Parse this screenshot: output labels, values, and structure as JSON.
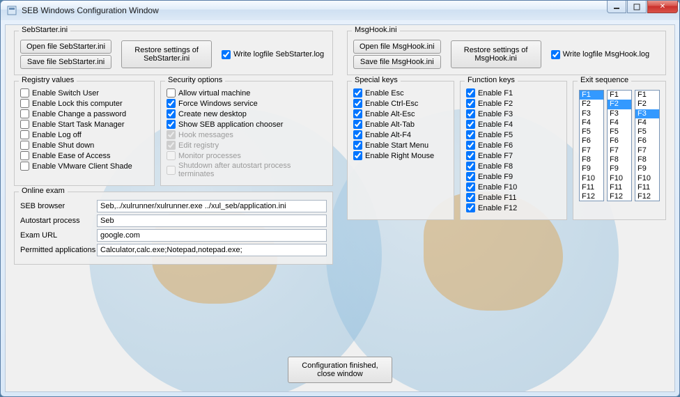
{
  "window": {
    "title": "SEB Windows Configuration Window"
  },
  "sebstarter": {
    "legend": "SebStarter.ini",
    "open_btn": "Open file SebStarter.ini",
    "save_btn": "Save file SebStarter.ini",
    "restore_btn": "Restore settings of\nSebStarter.ini",
    "logfile_label": "Write logfile SebStarter.log",
    "logfile_checked": true
  },
  "registry": {
    "legend": "Registry values",
    "items": [
      {
        "label": "Enable Switch User",
        "checked": false
      },
      {
        "label": "Enable Lock this computer",
        "checked": false
      },
      {
        "label": "Enable Change a password",
        "checked": false
      },
      {
        "label": "Enable Start Task Manager",
        "checked": false
      },
      {
        "label": "Enable Log off",
        "checked": false
      },
      {
        "label": "Enable Shut down",
        "checked": false
      },
      {
        "label": "Enable Ease of Access",
        "checked": false
      },
      {
        "label": "Enable VMware Client Shade",
        "checked": false
      }
    ]
  },
  "security": {
    "legend": "Security options",
    "items": [
      {
        "label": "Allow virtual machine",
        "checked": false,
        "disabled": false
      },
      {
        "label": "Force Windows service",
        "checked": true,
        "disabled": false
      },
      {
        "label": "Create new desktop",
        "checked": true,
        "disabled": false
      },
      {
        "label": "Show SEB application chooser",
        "checked": true,
        "disabled": false
      },
      {
        "label": "Hook messages",
        "checked": true,
        "disabled": true
      },
      {
        "label": "Edit registry",
        "checked": true,
        "disabled": true
      },
      {
        "label": "Monitor processes",
        "checked": false,
        "disabled": true
      },
      {
        "label": "Shutdown after autostart process terminates",
        "checked": false,
        "disabled": true
      }
    ]
  },
  "online_exam": {
    "legend": "Online exam",
    "seb_browser_label": "SEB browser",
    "seb_browser_value": "Seb,../xulrunner/xulrunner.exe ../xul_seb/application.ini",
    "autostart_label": "Autostart process",
    "autostart_value": "Seb",
    "exam_url_label": "Exam URL",
    "exam_url_value": "google.com",
    "permitted_label": "Permitted applications",
    "permitted_value": "Calculator,calc.exe;Notepad,notepad.exe;"
  },
  "msghook": {
    "legend": "MsgHook.ini",
    "open_btn": "Open file MsgHook.ini",
    "save_btn": "Save file MsgHook.ini",
    "restore_btn": "Restore settings of\nMsgHook.ini",
    "logfile_label": "Write logfile MsgHook.log",
    "logfile_checked": true
  },
  "special_keys": {
    "legend": "Special keys",
    "items": [
      {
        "label": "Enable Esc",
        "checked": true
      },
      {
        "label": "Enable Ctrl-Esc",
        "checked": true
      },
      {
        "label": "Enable Alt-Esc",
        "checked": true
      },
      {
        "label": "Enable Alt-Tab",
        "checked": true
      },
      {
        "label": "Enable Alt-F4",
        "checked": true
      },
      {
        "label": "Enable Start Menu",
        "checked": true
      },
      {
        "label": "Enable Right Mouse",
        "checked": true
      }
    ]
  },
  "function_keys": {
    "legend": "Function keys",
    "items": [
      {
        "label": "Enable F1",
        "checked": true
      },
      {
        "label": "Enable F2",
        "checked": true
      },
      {
        "label": "Enable F3",
        "checked": true
      },
      {
        "label": "Enable F4",
        "checked": true
      },
      {
        "label": "Enable F5",
        "checked": true
      },
      {
        "label": "Enable F6",
        "checked": true
      },
      {
        "label": "Enable F7",
        "checked": true
      },
      {
        "label": "Enable F8",
        "checked": true
      },
      {
        "label": "Enable F9",
        "checked": true
      },
      {
        "label": "Enable F10",
        "checked": true
      },
      {
        "label": "Enable F11",
        "checked": true
      },
      {
        "label": "Enable F12",
        "checked": true
      }
    ]
  },
  "exit_sequence": {
    "legend": "Exit sequence",
    "options": [
      "F1",
      "F2",
      "F3",
      "F4",
      "F5",
      "F6",
      "F7",
      "F8",
      "F9",
      "F10",
      "F11",
      "F12"
    ],
    "selected": [
      "F1",
      "F2",
      "F3"
    ]
  },
  "finish_btn": "Configuration finished,\nclose window"
}
